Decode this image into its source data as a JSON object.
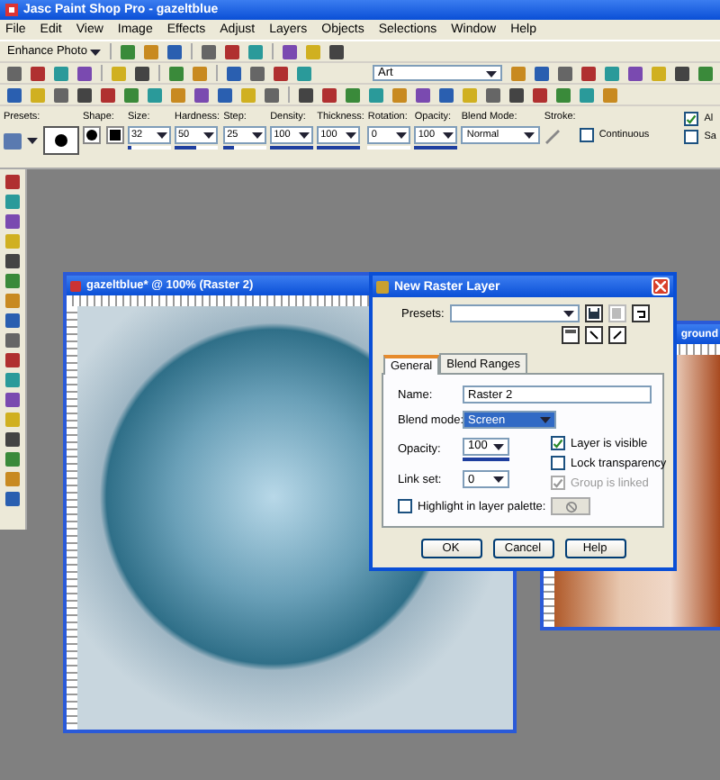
{
  "window": {
    "title": "Jasc Paint Shop Pro - gazeltblue"
  },
  "menu": [
    "File",
    "Edit",
    "View",
    "Image",
    "Effects",
    "Adjust",
    "Layers",
    "Objects",
    "Selections",
    "Window",
    "Help"
  ],
  "toolbar": {
    "enhance_button": "Enhance Photo",
    "art_dropdown": "Art"
  },
  "tool_options": [
    {
      "kind": "presets",
      "label": "Presets:"
    },
    {
      "kind": "shape",
      "label": "Shape:"
    },
    {
      "kind": "spin",
      "label": "Size:",
      "value": "32",
      "level": 0.1
    },
    {
      "kind": "spin",
      "label": "Hardness:",
      "value": "50",
      "level": 0.5
    },
    {
      "kind": "spin",
      "label": "Step:",
      "value": "25",
      "level": 0.25
    },
    {
      "kind": "spin",
      "label": "Density:",
      "value": "100",
      "level": 1
    },
    {
      "kind": "spin",
      "label": "Thickness:",
      "value": "100",
      "level": 1
    },
    {
      "kind": "spin",
      "label": "Rotation:",
      "value": "0",
      "level": 0
    },
    {
      "kind": "spin",
      "label": "Opacity:",
      "value": "100",
      "level": 1
    },
    {
      "kind": "select",
      "label": "Blend Mode:",
      "value": "Normal"
    },
    {
      "kind": "stroke",
      "label": "Stroke:"
    },
    {
      "kind": "check",
      "label": "Continuous",
      "checked": false
    },
    {
      "kind": "checks",
      "items": [
        {
          "label": "Al",
          "checked": true
        },
        {
          "label": "Sa",
          "checked": false
        }
      ]
    }
  ],
  "image_window": {
    "title": "gazeltblue* @ 100% (Raster 2)"
  },
  "background_window": {
    "title": "ground"
  },
  "dialog": {
    "title": "New Raster Layer",
    "presets_label": "Presets:",
    "tabs": [
      {
        "label": "General",
        "selected": true
      },
      {
        "label": "Blend Ranges",
        "selected": false
      }
    ],
    "name_label": "Name:",
    "name_value": "Raster 2",
    "blend_label": "Blend mode:",
    "blend_value": "Screen",
    "opacity": {
      "label": "Opacity:",
      "value": "100",
      "level": 1
    },
    "link_label": "Link set:",
    "link_value": "0",
    "checks": [
      {
        "label": "Layer is visible",
        "checked": true,
        "disabled": false
      },
      {
        "label": "Lock transparency",
        "checked": false,
        "disabled": false
      },
      {
        "label": "Group is linked",
        "checked": true,
        "disabled": true
      }
    ],
    "highlight": {
      "label": "Highlight in layer palette:",
      "checked": false
    },
    "buttons": [
      "OK",
      "Cancel",
      "Help"
    ]
  }
}
